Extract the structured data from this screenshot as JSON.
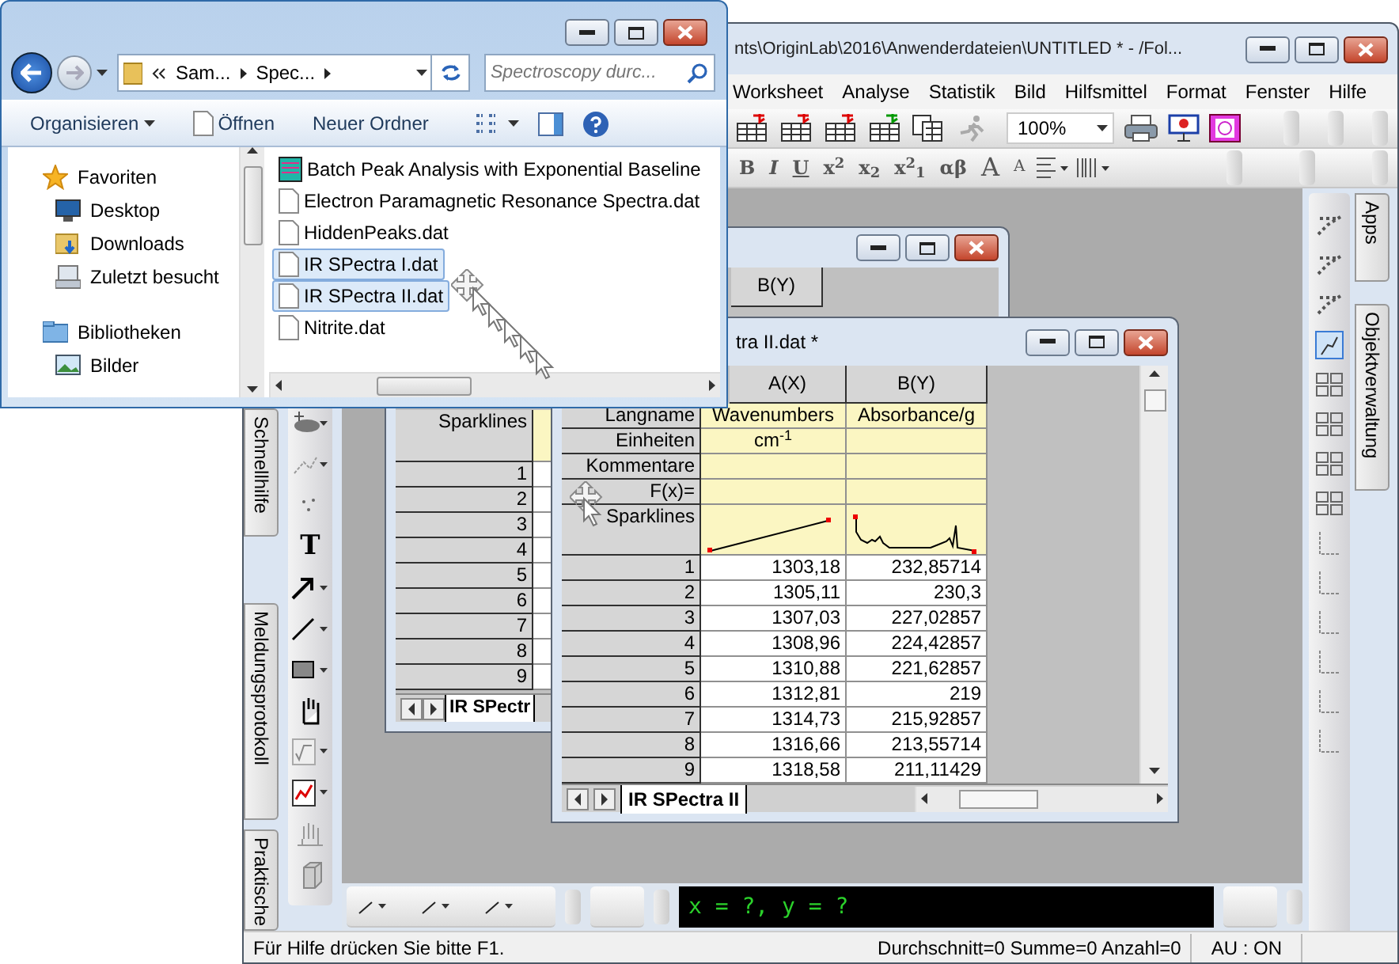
{
  "explorer": {
    "breadcrumb": [
      "Sam...",
      "Spec..."
    ],
    "search": {
      "placeholder": "Spectroscopy durc..."
    },
    "commands": [
      "Organisieren",
      "Öffnen",
      "Neuer Ordner"
    ],
    "nav": [
      {
        "label": "Favoriten",
        "kind": "group"
      },
      {
        "label": "Desktop",
        "kind": "item"
      },
      {
        "label": "Downloads",
        "kind": "item"
      },
      {
        "label": "Zuletzt besucht",
        "kind": "item"
      },
      {
        "label": "Bibliotheken",
        "kind": "group"
      },
      {
        "label": "Bilder",
        "kind": "item"
      }
    ],
    "files": [
      {
        "name": "Batch Peak Analysis with Exponential Baseline",
        "kind": "project",
        "selected": false
      },
      {
        "name": "Electron Paramagnetic Resonance Spectra.dat",
        "kind": "file",
        "selected": false
      },
      {
        "name": "HiddenPeaks.dat",
        "kind": "file",
        "selected": false
      },
      {
        "name": "IR SPectra I.dat",
        "kind": "file",
        "selected": true
      },
      {
        "name": "IR SPectra II.dat",
        "kind": "file",
        "selected": true
      },
      {
        "name": "Nitrite.dat",
        "kind": "file",
        "selected": false
      }
    ]
  },
  "origin": {
    "title": "nts\\OriginLab\\2016\\Anwenderdateien\\UNTITLED * - /Fol...",
    "menu": [
      "Worksheet",
      "Analyse",
      "Statistik",
      "Bild",
      "Hilfsmittel",
      "Format",
      "Fenster",
      "Hilfe"
    ],
    "zoom": "100%",
    "format_buttons": [
      {
        "label": "B",
        "kind": "bold"
      },
      {
        "label": "I",
        "kind": "italic"
      },
      {
        "label": "U",
        "kind": "underline"
      },
      {
        "label": "x$^{2}$",
        "kind": "plain"
      },
      {
        "label": "x$_{2}$",
        "kind": "plain"
      },
      {
        "label": "x$^{2}$$_{1}$",
        "kind": "plain"
      },
      {
        "label": "αβ",
        "kind": "plain"
      },
      {
        "label": "A",
        "kind": "grow"
      },
      {
        "label": "A",
        "kind": "shrink"
      }
    ],
    "text_tool": "T",
    "left_tabs": [
      "Schnellhilfe",
      "Meldungsprotokoll",
      "Praktische"
    ],
    "right_tabs": [
      "Apps",
      "Objektverwaltung"
    ],
    "command_line": "x = ?, y = ?",
    "status_bar": {
      "hint": "Für Hilfe drücken Sie bitte F1.",
      "stats": "Durchschnitt=0 Summe=0 Anzahl=0",
      "mode": "AU : ON"
    }
  },
  "back_sheet": {
    "column": "B(Y)",
    "label_row": "Sparklines",
    "row_numbers": [
      "1",
      "2",
      "3",
      "4",
      "5",
      "6",
      "7",
      "8",
      "9"
    ],
    "tab": "IR SPectr"
  },
  "front_sheet": {
    "title": "tra II.dat *",
    "columns": [
      "A(X)",
      "B(Y)"
    ],
    "labels": [
      {
        "label": "Langname",
        "values": [
          "Wavenumbers",
          "Absorbance/g"
        ]
      },
      {
        "label": "Einheiten",
        "values": [
          "cm$^{-1}$"
        ]
      },
      {
        "label": "Kommentare"
      },
      {
        "label": "F(x)="
      }
    ],
    "sparkline_label": "Sparklines",
    "rows": [
      {
        "n": "1",
        "a": "1303,18",
        "b": "232,85714"
      },
      {
        "n": "2",
        "a": "1305,11",
        "b": "230,3"
      },
      {
        "n": "3",
        "a": "1307,03",
        "b": "227,02857"
      },
      {
        "n": "4",
        "a": "1308,96",
        "b": "224,42857"
      },
      {
        "n": "5",
        "a": "1310,88",
        "b": "221,62857"
      },
      {
        "n": "6",
        "a": "1312,81",
        "b": "219"
      },
      {
        "n": "7",
        "a": "1314,73",
        "b": "215,92857"
      },
      {
        "n": "8",
        "a": "1316,66",
        "b": "213,55714"
      },
      {
        "n": "9",
        "a": "1318,58",
        "b": "211,11429"
      }
    ],
    "tab": "IR SPectra II"
  }
}
